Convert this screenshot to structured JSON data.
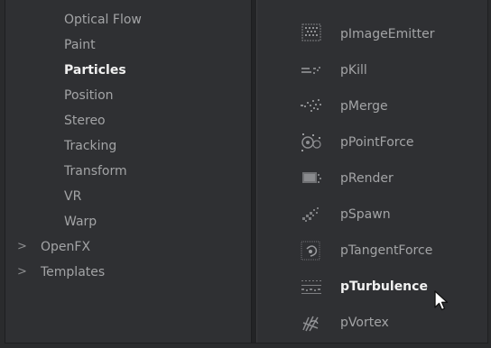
{
  "tree": {
    "items": [
      {
        "label": "Optical Flow",
        "selected": false
      },
      {
        "label": "Paint",
        "selected": false
      },
      {
        "label": "Particles",
        "selected": true
      },
      {
        "label": "Position",
        "selected": false
      },
      {
        "label": "Stereo",
        "selected": false
      },
      {
        "label": "Tracking",
        "selected": false
      },
      {
        "label": "Transform",
        "selected": false
      },
      {
        "label": "VR",
        "selected": false
      },
      {
        "label": "Warp",
        "selected": false
      }
    ],
    "groups": [
      {
        "label": "OpenFX",
        "chevron": "chevron-right-icon"
      },
      {
        "label": "Templates",
        "chevron": "chevron-right-icon"
      }
    ]
  },
  "tools": [
    {
      "label": "pImageEmitter",
      "icon": "image-emitter-icon"
    },
    {
      "label": "pKill",
      "icon": "kill-icon"
    },
    {
      "label": "pMerge",
      "icon": "merge-icon"
    },
    {
      "label": "pPointForce",
      "icon": "point-force-icon"
    },
    {
      "label": "pRender",
      "icon": "render-icon"
    },
    {
      "label": "pSpawn",
      "icon": "spawn-icon"
    },
    {
      "label": "pTangentForce",
      "icon": "tangent-force-icon"
    },
    {
      "label": "pTurbulence",
      "icon": "turbulence-icon",
      "hovered": true
    },
    {
      "label": "pVortex",
      "icon": "vortex-icon"
    }
  ],
  "chevron_glyph": ">",
  "colors": {
    "panel_bg": "#2f3033",
    "text": "#a3a4a6",
    "text_highlight": "#f0f0f0",
    "icon_gray": "#8a8b8e"
  }
}
